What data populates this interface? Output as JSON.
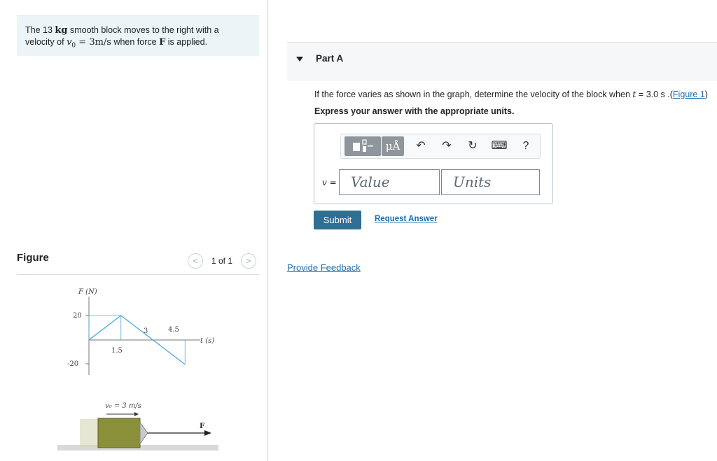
{
  "problem": {
    "t1": "The 13 ",
    "mass_unit": "kg",
    "t2": " smooth block moves to the right with a",
    "t3": "velocity of ",
    "v0_sym": "v",
    "v0_sub": "0",
    "v0_eq": " = 3m/s",
    "t4": " when force ",
    "force_sym": "F",
    "t5": " is applied."
  },
  "figure": {
    "label": "Figure",
    "pager_text": "1 of 1",
    "graph": {
      "ylabel": "F (N)",
      "xlabel": "t (s)",
      "y_ticks": [
        "20",
        "-20"
      ],
      "x_ticks": [
        "1.5",
        "3",
        "4.5"
      ],
      "caption": "v₀ = 3 m/s",
      "force_label": "F",
      "line_color": "#4aa8d8",
      "block_color": "#8a8f3a"
    },
    "chart_data": {
      "type": "line",
      "xlabel": "t (s)",
      "ylabel": "F (N)",
      "x": [
        0,
        1.5,
        3,
        4.5
      ],
      "y": [
        0,
        20,
        0,
        -20
      ]
    }
  },
  "part": {
    "title": "Part A",
    "question_pre": "If the force varies as shown in the graph, determine the velocity of the block when ",
    "t_sym": "t",
    "question_post": " = 3.0 s .(",
    "figure_link": "Figure 1",
    "question_end": ")",
    "instructions": "Express your answer with the appropriate units.",
    "toolbar": {
      "mu_label": "μÅ",
      "undo": "↶",
      "redo": "↷",
      "reset": "↻",
      "keyboard": "⌨",
      "help": "?"
    },
    "answer_var": "v",
    "answer_eq": " =",
    "value_placeholder": "Value",
    "units_placeholder": "Units",
    "submit_label": "Submit",
    "request_answer": "Request Answer"
  },
  "feedback_link": "Provide Feedback",
  "colors": {
    "accent": "#2f6f93",
    "link": "#1a6eab"
  }
}
